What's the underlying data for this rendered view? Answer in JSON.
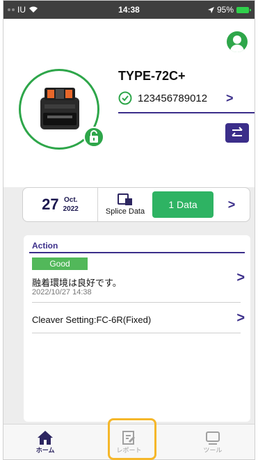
{
  "status_bar": {
    "carrier": "IU",
    "time": "14:38",
    "battery": "95%"
  },
  "device": {
    "name": "TYPE-72C+",
    "serial": "123456789012"
  },
  "splice_card": {
    "day": "27",
    "month": "Oct.",
    "year": "2022",
    "splice_label": "Splice Data",
    "data_button": "1 Data"
  },
  "action": {
    "title": "Action",
    "items": [
      {
        "badge": "Good",
        "message": "融着環境は良好です。",
        "timestamp": "2022/10/27 14:38"
      },
      {
        "message": "Cleaver Setting:FC-6R(Fixed)"
      }
    ]
  },
  "tabbar": {
    "tabs": [
      {
        "label": "ホーム"
      },
      {
        "label": "レポート"
      },
      {
        "label": "ツール"
      }
    ]
  },
  "colors": {
    "accent": "#3b2e8a",
    "green": "#2ea64a",
    "data_button": "#2eb363",
    "highlight": "#f5b72a"
  }
}
